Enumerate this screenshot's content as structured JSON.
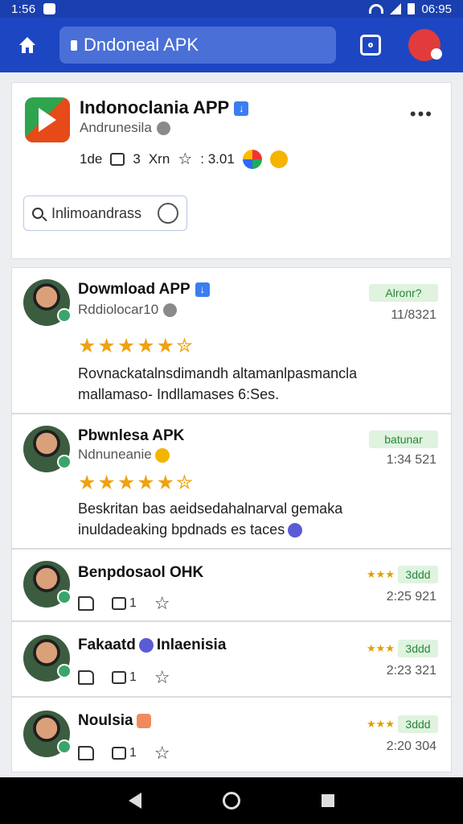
{
  "status_bar": {
    "time": "1:56",
    "clock_right": "06:95"
  },
  "browser": {
    "url_text": "Dndoneal APK"
  },
  "app": {
    "title": "Indonoclania APP",
    "subtitle": "Andrunesila",
    "stat_a": "1de",
    "stat_b": "3",
    "stat_c": "Xrn",
    "stat_d": ": 3.01",
    "search_chip": "Inlimoandrass"
  },
  "reviews": [
    {
      "title": "Dowmload APP",
      "subtitle": "Rddiolocar10",
      "badge": "Alronr?",
      "date": "11/8321",
      "stars": "★★★★★✮",
      "text_line1": "Rovnackatalnsdimandh altamanlpasmancla",
      "text_line2": "mallamaso- Indllamases 6:Ses."
    },
    {
      "title": "Pbwnlesa APK",
      "subtitle": "Ndnuneanie",
      "badge": "batunar",
      "date": "1:34 521",
      "stars": "★★★★★✮",
      "text_line1": "Beskritan bas aeidsedahalnarval gemaka",
      "text_line2": "inuldadeaking bpdnads es taces"
    },
    {
      "title": "Benpdosaol OHK",
      "mini_label": "3ddd",
      "date": "2:25 921",
      "comment_count": "1"
    },
    {
      "title": "Fakaatd",
      "title_suffix": "Inlaenisia",
      "mini_label": "3ddd",
      "date": "2:23 321",
      "comment_count": "1"
    },
    {
      "title": "Noulsia",
      "mini_label": "3ddd",
      "date": "2:20 304",
      "comment_count": "1"
    }
  ],
  "mini_stars_text": "★★★",
  "colors": {
    "appbar": "#1d46c3",
    "statusbar": "#1a3fae",
    "star": "#f0a20f",
    "badge_green": "#27863a"
  }
}
